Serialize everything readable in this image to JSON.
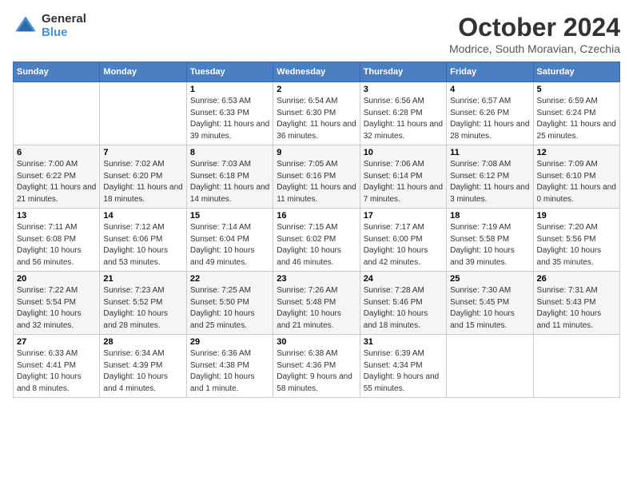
{
  "logo": {
    "general": "General",
    "blue": "Blue"
  },
  "header": {
    "title": "October 2024",
    "subtitle": "Modrice, South Moravian, Czechia"
  },
  "weekdays": [
    "Sunday",
    "Monday",
    "Tuesday",
    "Wednesday",
    "Thursday",
    "Friday",
    "Saturday"
  ],
  "weeks": [
    [
      {
        "day": "",
        "info": ""
      },
      {
        "day": "",
        "info": ""
      },
      {
        "day": "1",
        "info": "Sunrise: 6:53 AM\nSunset: 6:33 PM\nDaylight: 11 hours and 39 minutes."
      },
      {
        "day": "2",
        "info": "Sunrise: 6:54 AM\nSunset: 6:30 PM\nDaylight: 11 hours and 36 minutes."
      },
      {
        "day": "3",
        "info": "Sunrise: 6:56 AM\nSunset: 6:28 PM\nDaylight: 11 hours and 32 minutes."
      },
      {
        "day": "4",
        "info": "Sunrise: 6:57 AM\nSunset: 6:26 PM\nDaylight: 11 hours and 28 minutes."
      },
      {
        "day": "5",
        "info": "Sunrise: 6:59 AM\nSunset: 6:24 PM\nDaylight: 11 hours and 25 minutes."
      }
    ],
    [
      {
        "day": "6",
        "info": "Sunrise: 7:00 AM\nSunset: 6:22 PM\nDaylight: 11 hours and 21 minutes."
      },
      {
        "day": "7",
        "info": "Sunrise: 7:02 AM\nSunset: 6:20 PM\nDaylight: 11 hours and 18 minutes."
      },
      {
        "day": "8",
        "info": "Sunrise: 7:03 AM\nSunset: 6:18 PM\nDaylight: 11 hours and 14 minutes."
      },
      {
        "day": "9",
        "info": "Sunrise: 7:05 AM\nSunset: 6:16 PM\nDaylight: 11 hours and 11 minutes."
      },
      {
        "day": "10",
        "info": "Sunrise: 7:06 AM\nSunset: 6:14 PM\nDaylight: 11 hours and 7 minutes."
      },
      {
        "day": "11",
        "info": "Sunrise: 7:08 AM\nSunset: 6:12 PM\nDaylight: 11 hours and 3 minutes."
      },
      {
        "day": "12",
        "info": "Sunrise: 7:09 AM\nSunset: 6:10 PM\nDaylight: 11 hours and 0 minutes."
      }
    ],
    [
      {
        "day": "13",
        "info": "Sunrise: 7:11 AM\nSunset: 6:08 PM\nDaylight: 10 hours and 56 minutes."
      },
      {
        "day": "14",
        "info": "Sunrise: 7:12 AM\nSunset: 6:06 PM\nDaylight: 10 hours and 53 minutes."
      },
      {
        "day": "15",
        "info": "Sunrise: 7:14 AM\nSunset: 6:04 PM\nDaylight: 10 hours and 49 minutes."
      },
      {
        "day": "16",
        "info": "Sunrise: 7:15 AM\nSunset: 6:02 PM\nDaylight: 10 hours and 46 minutes."
      },
      {
        "day": "17",
        "info": "Sunrise: 7:17 AM\nSunset: 6:00 PM\nDaylight: 10 hours and 42 minutes."
      },
      {
        "day": "18",
        "info": "Sunrise: 7:19 AM\nSunset: 5:58 PM\nDaylight: 10 hours and 39 minutes."
      },
      {
        "day": "19",
        "info": "Sunrise: 7:20 AM\nSunset: 5:56 PM\nDaylight: 10 hours and 35 minutes."
      }
    ],
    [
      {
        "day": "20",
        "info": "Sunrise: 7:22 AM\nSunset: 5:54 PM\nDaylight: 10 hours and 32 minutes."
      },
      {
        "day": "21",
        "info": "Sunrise: 7:23 AM\nSunset: 5:52 PM\nDaylight: 10 hours and 28 minutes."
      },
      {
        "day": "22",
        "info": "Sunrise: 7:25 AM\nSunset: 5:50 PM\nDaylight: 10 hours and 25 minutes."
      },
      {
        "day": "23",
        "info": "Sunrise: 7:26 AM\nSunset: 5:48 PM\nDaylight: 10 hours and 21 minutes."
      },
      {
        "day": "24",
        "info": "Sunrise: 7:28 AM\nSunset: 5:46 PM\nDaylight: 10 hours and 18 minutes."
      },
      {
        "day": "25",
        "info": "Sunrise: 7:30 AM\nSunset: 5:45 PM\nDaylight: 10 hours and 15 minutes."
      },
      {
        "day": "26",
        "info": "Sunrise: 7:31 AM\nSunset: 5:43 PM\nDaylight: 10 hours and 11 minutes."
      }
    ],
    [
      {
        "day": "27",
        "info": "Sunrise: 6:33 AM\nSunset: 4:41 PM\nDaylight: 10 hours and 8 minutes."
      },
      {
        "day": "28",
        "info": "Sunrise: 6:34 AM\nSunset: 4:39 PM\nDaylight: 10 hours and 4 minutes."
      },
      {
        "day": "29",
        "info": "Sunrise: 6:36 AM\nSunset: 4:38 PM\nDaylight: 10 hours and 1 minute."
      },
      {
        "day": "30",
        "info": "Sunrise: 6:38 AM\nSunset: 4:36 PM\nDaylight: 9 hours and 58 minutes."
      },
      {
        "day": "31",
        "info": "Sunrise: 6:39 AM\nSunset: 4:34 PM\nDaylight: 9 hours and 55 minutes."
      },
      {
        "day": "",
        "info": ""
      },
      {
        "day": "",
        "info": ""
      }
    ]
  ]
}
